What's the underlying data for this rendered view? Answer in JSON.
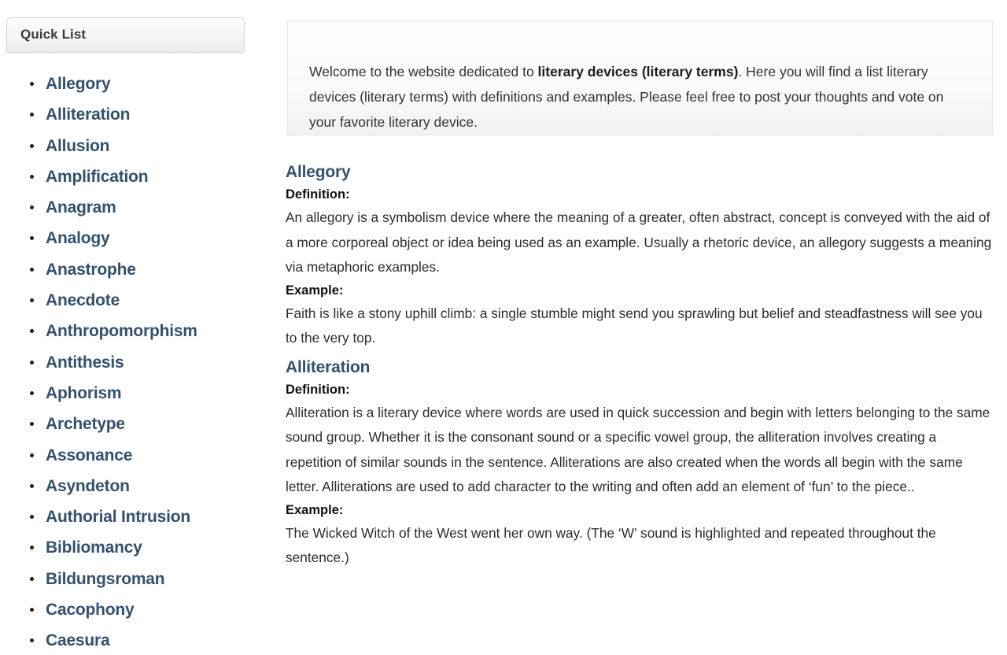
{
  "sidebar": {
    "panel_title": "Quick List",
    "items": [
      {
        "label": "Allegory"
      },
      {
        "label": "Alliteration"
      },
      {
        "label": "Allusion"
      },
      {
        "label": "Amplification"
      },
      {
        "label": "Anagram"
      },
      {
        "label": "Analogy"
      },
      {
        "label": "Anastrophe"
      },
      {
        "label": "Anecdote"
      },
      {
        "label": "Anthropomorphism"
      },
      {
        "label": "Antithesis"
      },
      {
        "label": "Aphorism"
      },
      {
        "label": "Archetype"
      },
      {
        "label": "Assonance"
      },
      {
        "label": "Asyndeton"
      },
      {
        "label": "Authorial Intrusion"
      },
      {
        "label": "Bibliomancy"
      },
      {
        "label": "Bildungsroman"
      },
      {
        "label": "Cacophony"
      },
      {
        "label": "Caesura"
      }
    ]
  },
  "welcome": {
    "part1": "Welcome to the website dedicated to ",
    "emphasis": "literary devices (literary terms)",
    "part2": ". Here you will find a list literary devices (literary terms) with definitions and examples. Please feel free to post your thoughts and vote on your favorite literary device."
  },
  "labels": {
    "definition": "Definition:",
    "example": "Example:"
  },
  "entries": [
    {
      "title": "Allegory",
      "definition": "An allegory is a symbolism device where the meaning of a greater, often abstract, concept is conveyed with the aid of a more corporeal object or idea being used as an example. Usually a rhetoric device, an allegory suggests a meaning via metaphoric examples.",
      "example": "Faith is like a stony uphill climb: a single stumble might send you sprawling but belief and steadfastness will see you to the very top."
    },
    {
      "title": "Alliteration",
      "definition": "Alliteration is a literary device where words are used in quick succession and begin with letters belonging to the same sound group. Whether it is the consonant sound or a specific vowel group, the alliteration involves creating a repetition of similar sounds in the sentence. Alliterations are also created when the words all begin with the same letter. Alliterations are used to add character to the writing and often add an element of ‘fun’ to the piece..",
      "example": "The Wicked Witch of the West went her own way. (The ‘W’ sound is highlighted and repeated throughout the sentence.)"
    }
  ],
  "colors": {
    "link": "#33506e",
    "heading": "#33506e",
    "body": "#2c2c2c",
    "panel_border": "#d8d8d8"
  }
}
